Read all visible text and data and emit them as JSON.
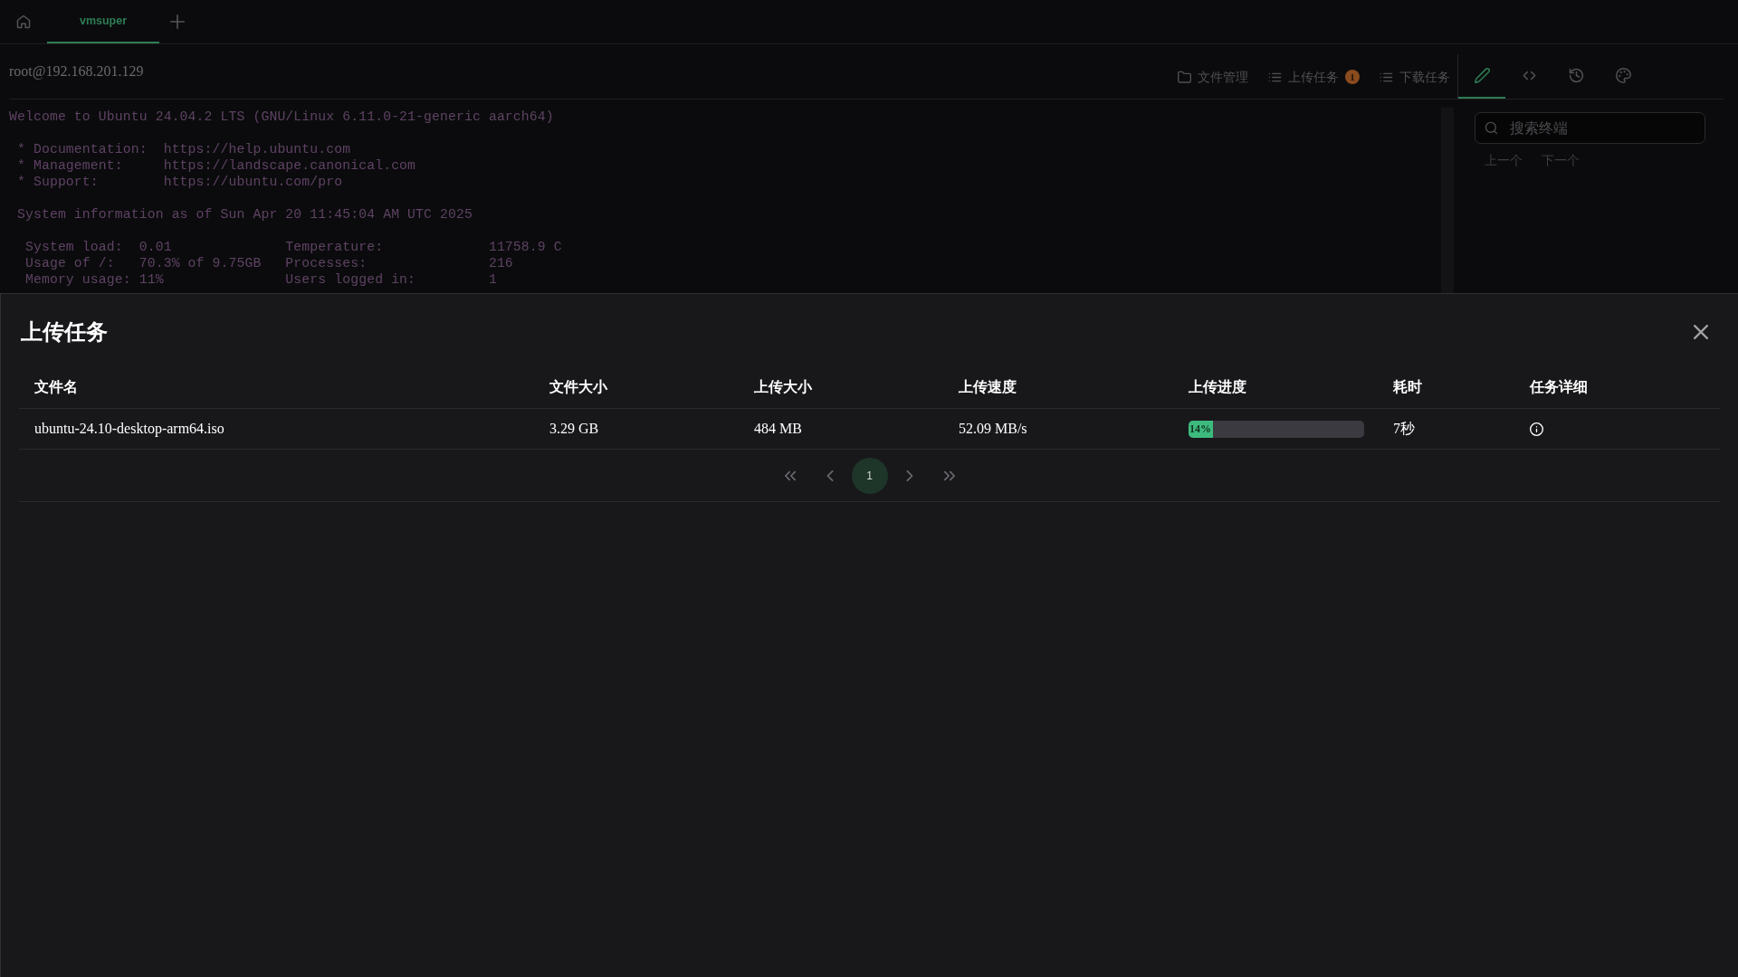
{
  "tabs": [
    {
      "label": "vmsuper",
      "selected": true
    }
  ],
  "connection": {
    "host": "root@192.168.201.129"
  },
  "toolbar": {
    "actions": [
      {
        "label": "文件管理"
      },
      {
        "label": "上传任务",
        "badge": "1"
      },
      {
        "label": "下载任务"
      }
    ],
    "panel_tabs": [
      {
        "selected": true
      },
      {
        "selected": false
      },
      {
        "selected": false
      },
      {
        "selected": false
      }
    ]
  },
  "terminal": {
    "blocks": [
      [
        "Welcome to Ubuntu 24.04.2 LTS (GNU/Linux 6.11.0-21-generic aarch64)"
      ],
      [
        " * Documentation:  https://help.ubuntu.com",
        " * Management:     https://landscape.canonical.com",
        " * Support:        https://ubuntu.com/pro"
      ],
      [
        " System information as of Sun Apr 20 11:45:04 AM UTC 2025"
      ],
      [
        "  System load:  0.01              Temperature:             11758.9 C",
        "  Usage of /:   70.3% of 9.75GB   Processes:               216",
        "  Memory usage: 11%               Users logged in:         1"
      ]
    ]
  },
  "search_panel": {
    "placeholder": "搜索终端",
    "prev": "上一个",
    "next": "下一个"
  },
  "upload_drawer": {
    "title": "上传任务",
    "table": {
      "columns": [
        "文件名",
        "文件大小",
        "上传大小",
        "上传速度",
        "上传进度",
        "耗时",
        "任务详细"
      ],
      "rows": [
        {
          "file_name": "ubuntu-24.10-desktop-arm64.iso",
          "file_size": "3.29 GB",
          "uploaded_size": "484 MB",
          "speed": "52.09 MB/s",
          "progress": {
            "level": 0.14,
            "label": "14%"
          },
          "elapsed": "7秒"
        }
      ]
    },
    "pagination": {
      "pages": [
        {
          "label": "1",
          "selected": true
        }
      ]
    }
  }
}
